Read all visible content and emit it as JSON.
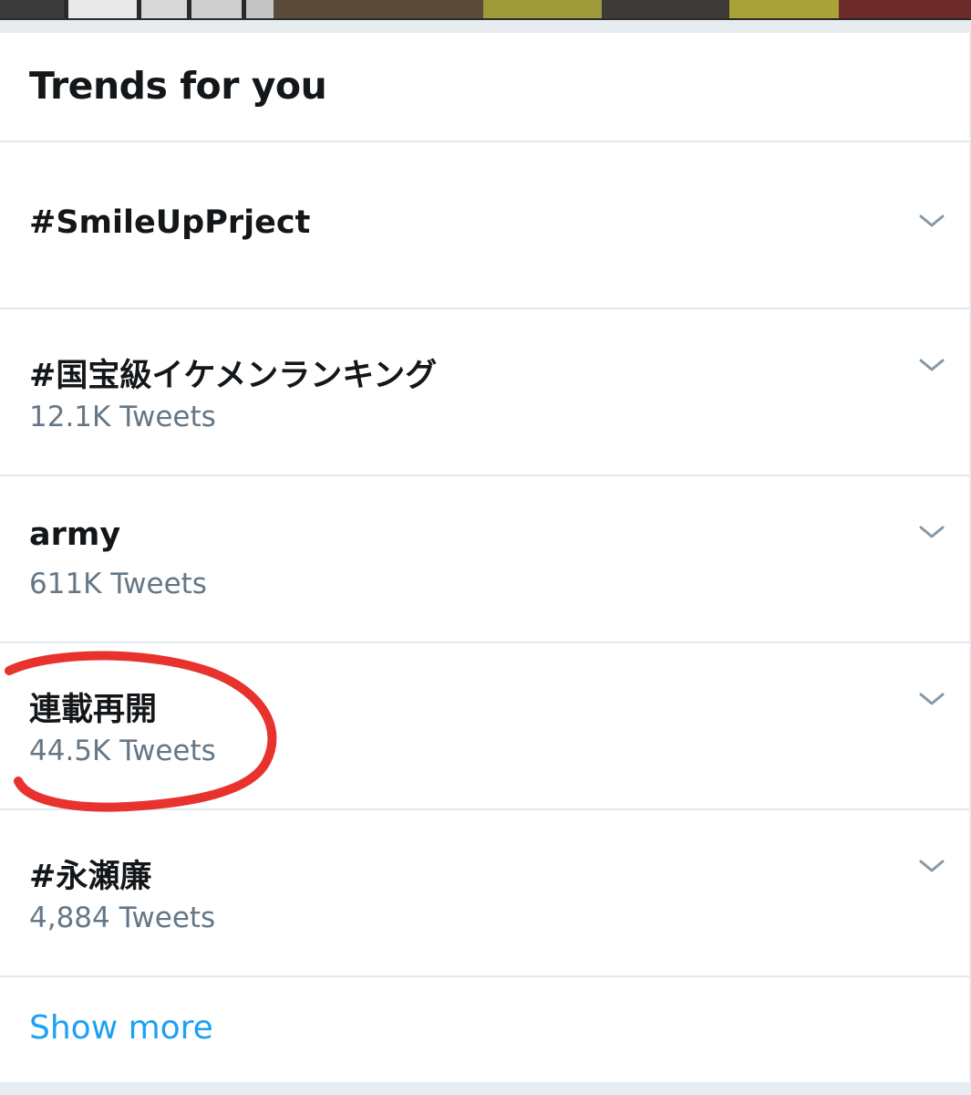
{
  "title": "Trends for you",
  "trends": [
    {
      "name": "#SmileUpPrject",
      "count": ""
    },
    {
      "name": "#国宝級イケメンランキング",
      "count": "12.1K Tweets"
    },
    {
      "name": "army",
      "count": "611K Tweets"
    },
    {
      "name": "連載再開",
      "count": "44.5K Tweets"
    },
    {
      "name": "#永瀬廉",
      "count": "4,884 Tweets"
    }
  ],
  "show_more_label": "Show more",
  "icons": {
    "trend_menu": "chevron-down-icon"
  },
  "colors": {
    "text_primary": "#14171a",
    "text_secondary": "#657786",
    "link": "#1da1f2",
    "divider": "#e1e8ed",
    "annotation": "#e8322d"
  }
}
